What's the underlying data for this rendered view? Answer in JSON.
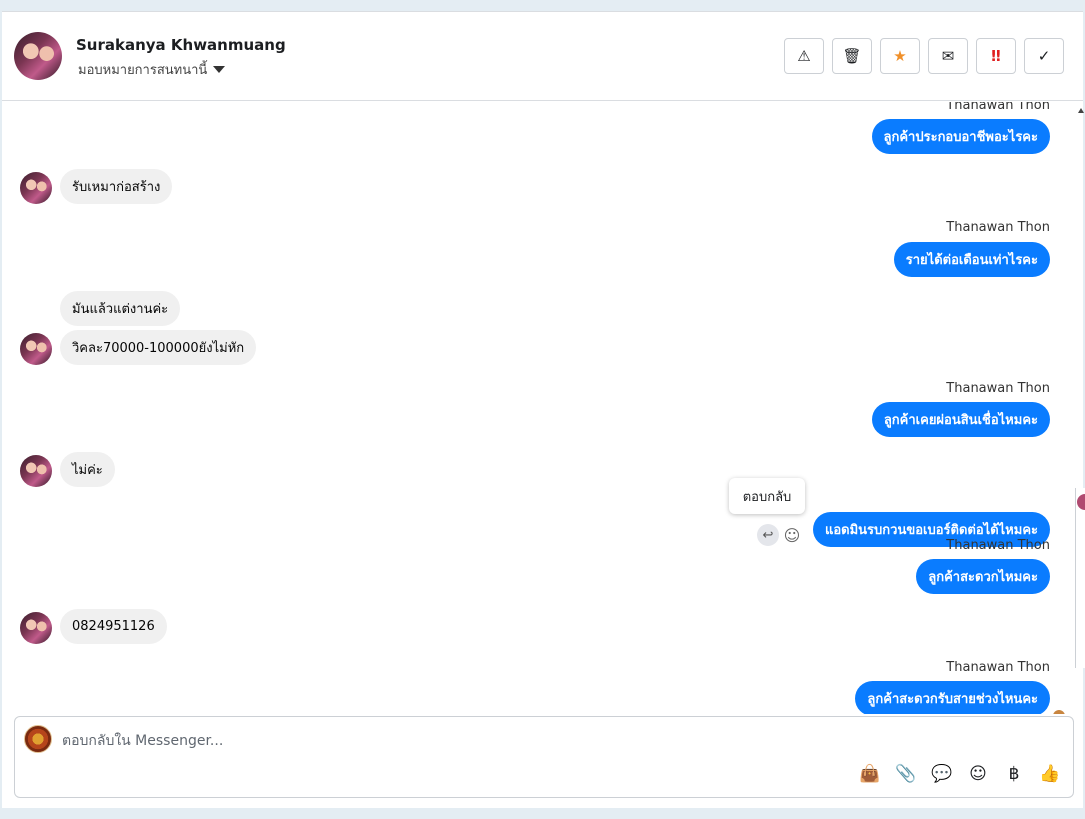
{
  "header": {
    "contact_name": "Surakanya Khwanmuang",
    "assign_label": "มอบหมายการสนทนานี้",
    "toolbar": [
      "warning-icon",
      "trash-icon",
      "star-icon",
      "mail-icon",
      "urgent-icon",
      "check-icon"
    ]
  },
  "thread": {
    "messages": [
      {
        "direction": "out",
        "sender": "Thanawan Thon",
        "text": "ลูกค้าประกอบอาชีพอะไรคะ"
      },
      {
        "direction": "in",
        "text": "รับเหมาก่อสร้าง"
      },
      {
        "direction": "out",
        "sender": "Thanawan Thon",
        "text": "รายได้ต่อเดือนเท่าไรคะ"
      },
      {
        "direction": "in",
        "text": "มันแล้วแต่งานค่ะ"
      },
      {
        "direction": "in",
        "text": "วิคละ70000-100000ยังไม่หัก"
      },
      {
        "direction": "out",
        "sender": "Thanawan Thon",
        "text": "ลูกค้าเคยผ่อนสินเชื่อไหมคะ"
      },
      {
        "direction": "in",
        "text": "ไม่ค่ะ"
      },
      {
        "direction": "out",
        "text": "แอดมินรบกวนขอเบอร์ติดต่อได้ไหมคะ"
      },
      {
        "direction": "out",
        "sender": "Thanawan Thon",
        "text": "ลูกค้าสะดวกไหมคะ"
      },
      {
        "direction": "in",
        "text": "0824951126"
      },
      {
        "direction": "out",
        "sender": "Thanawan Thon",
        "text": "ลูกค้าสะดวกรับสายช่วงไหนคะ"
      }
    ],
    "tooltip": "ตอบกลับ"
  },
  "composer": {
    "placeholder": "ตอบกลับใน Messenger...",
    "tools": [
      "bag-icon",
      "paperclip-icon",
      "chat-bubble-icon",
      "emoji-icon",
      "baht-icon",
      "thumbs-up-icon"
    ]
  },
  "colors": {
    "outgoing_bubble": "#0a7cff",
    "incoming_bubble": "#f0f0f0",
    "star": "#f0902a",
    "urgent": "#e02020"
  }
}
